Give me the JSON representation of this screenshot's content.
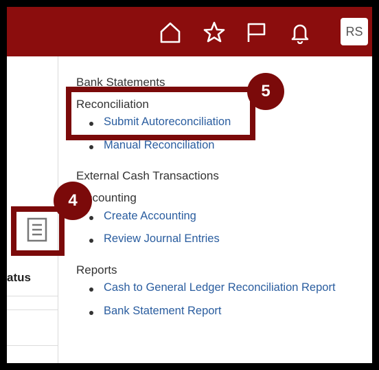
{
  "topbar": {
    "icons": [
      "home-icon",
      "star-icon",
      "flag-icon",
      "bell-icon"
    ],
    "avatar_initials": "RS",
    "color": "#8b0d0d"
  },
  "left_panel": {
    "column_header": "atus"
  },
  "menu": {
    "bank_statements": "Bank Statements",
    "reconciliation": "Reconciliation",
    "submit_autoreconciliation": "Submit Autoreconciliation",
    "manual_reconciliation": "Manual Reconciliation",
    "external_cash_transactions": "External Cash Transactions",
    "accounting": "ccounting",
    "create_accounting": "Create Accounting",
    "review_journal_entries": "Review Journal Entries",
    "reports": "Reports",
    "cash_to_gl_report": "Cash to General Ledger Reconciliation Report",
    "bank_statement_report": "Bank Statement Report"
  },
  "callouts": {
    "step4": "4",
    "step5": "5",
    "color": "#7b0a0a"
  }
}
